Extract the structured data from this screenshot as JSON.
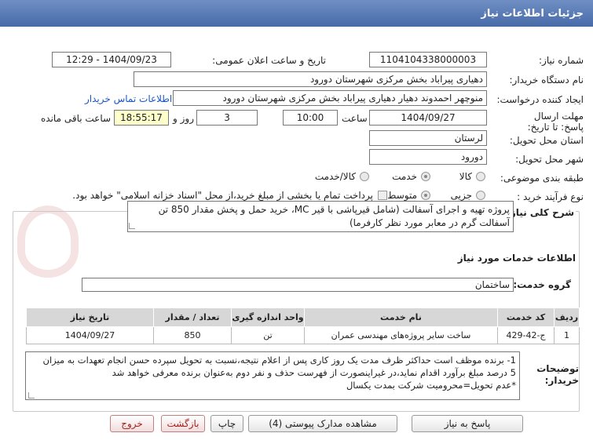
{
  "header": {
    "title": "جزئیات اطلاعات نیاز"
  },
  "fields": {
    "need_number_label": "شماره نیاز:",
    "need_number": "1104104338000003",
    "announce_label": "تاریخ و ساعت اعلان عمومی:",
    "announce_value": "1404/09/23 - 12:29",
    "buyer_org_label": "نام دستگاه خریدار:",
    "buyer_org": "دهیاری پیراباد بخش مرکزی شهرستان دورود",
    "creator_label": "ایجاد کننده درخواست:",
    "creator": "منوچهر احمدوند دهیار دهیاری پیراباد بخش مرکزی شهرستان دورود",
    "contact_link": "اطلاعات تماس خریدار",
    "deadline_label": "مهلت ارسال پاسخ: تا تاریخ:",
    "deadline_date": "1404/09/27",
    "time_label": "ساعت",
    "deadline_time": "10:00",
    "days_value": "3",
    "days_label": "روز و",
    "remaining_time": "18:55:17",
    "remaining_label": "ساعت باقی مانده",
    "province_label": "استان محل تحویل:",
    "province": "لرستان",
    "city_label": "شهر محل تحویل:",
    "city": "دورود",
    "category_label": "طبقه بندی موضوعی:",
    "category_options": [
      "کالا",
      "خدمت",
      "کالا/خدمت"
    ],
    "process_label": "نوع فرآیند خرید :",
    "process_options": [
      "جزیی",
      "متوسط"
    ],
    "payment_note": "پرداخت تمام یا بخشی از مبلغ خرید،از محل \"اسناد خزانه اسلامی\" خواهد بود."
  },
  "description": {
    "label": "شرح کلی نیاز:",
    "text": "پروژه تهیه و اجرای آسفالت (شامل قیرپاشی با قیر MC، خرید حمل و پخش مقدار 850 تن آسفالت گرم در معابر مورد نظر کارفرما)"
  },
  "services": {
    "section_title": "اطلاعات خدمات مورد نیاز",
    "group_label": "گروه خدمت:",
    "group_value": "ساختمان",
    "columns": [
      "ردیف",
      "کد خدمت",
      "نام خدمت",
      "واحد اندازه گیری",
      "تعداد / مقدار",
      "تاریخ نیاز"
    ],
    "rows": [
      {
        "row": "1",
        "code": "ج-42-429",
        "name": "ساخت سایر پروژه‌های مهندسی عمران",
        "unit": "تن",
        "qty": "850",
        "date": "1404/09/27"
      }
    ]
  },
  "buyer_notes": {
    "label": "توضیحات خریدار:",
    "lines": [
      "1- برنده موظف است حداکثر ظرف مدت یک روز کاری پس از اعلام نتیجه،نسبت به تحویل سپرده حسن انجام تعهدات به میزان",
      "5 درصد مبلغ برآورد اقدام نماید،در غیراینصورت از فهرست حذف و نفر دوم به‌عنوان برنده معرفی خواهد شد",
      "*عدم تحویل=محرومیت شرکت بمدت یکسال"
    ]
  },
  "buttons": {
    "reply": "پاسخ به نیاز",
    "attachments": "مشاهده مدارک پیوستی (4)",
    "print": "چاپ",
    "back": "بازگشت",
    "exit": "خروج"
  },
  "colors": {
    "header_bg": "#476aa8",
    "link": "#1a56c8"
  }
}
